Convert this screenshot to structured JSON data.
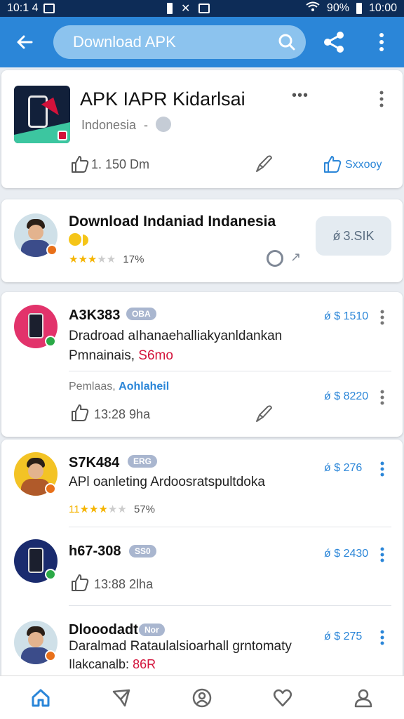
{
  "status_bar": {
    "left": "10:1 4",
    "right_signal": "90%",
    "time": "10:00"
  },
  "app_bar": {
    "search_value": "Download APK"
  },
  "card1": {
    "title": "APK IAPR Kidarlsai",
    "subtitle": "Indonesia",
    "like_count": "1. 150 Dm",
    "update_label": "Sxxooy"
  },
  "card2": {
    "title": "Download Indaniad Indanesia",
    "rating_pct": "17%",
    "rating_stars": 3,
    "side_button": "3.SIK"
  },
  "item1": {
    "name": "A3K383",
    "tag": "OBA",
    "desc_line1": "Dradroad aIhanaehalliakyanldankan",
    "desc_line2_prefix": "Pmnainais,",
    "desc_line2_accent": "S6mo",
    "count": "1510",
    "meta_prefix": "Pemlaas,",
    "meta_link": "Aohlaheil",
    "meta_count": "8220",
    "like_count": "13:28 9ha"
  },
  "item2": {
    "name": "S7K484",
    "tag": "ERG",
    "desc_line1": "APl oanleting Ardoosratspultdoka",
    "rating_prefix": "11",
    "rating_pct": "57%",
    "rating_stars": 3,
    "count": "276"
  },
  "item3": {
    "name": "h67-308",
    "tag": "SS0",
    "count": "2430",
    "like_count": "13:88 2lha"
  },
  "item4": {
    "name": "Dlooodadt",
    "tag": "Nor",
    "desc_line1": "Daralmad Rataulalsioarhall grntomaty",
    "desc_line2_prefix": "Ilakcanalb:",
    "desc_line2_accent": "86R",
    "count": "275"
  },
  "colors": {
    "status_bar": "#0d2c57",
    "app_bar": "#2b86d8",
    "accent_red": "#d3123a",
    "link_blue": "#2b86d8",
    "star": "#f5b400"
  },
  "icons": {
    "back": "back-arrow-icon",
    "search": "search-icon",
    "share": "share-icon",
    "more": "more-vert-icon",
    "like": "thumb-up-icon",
    "edit": "pen-icon"
  }
}
